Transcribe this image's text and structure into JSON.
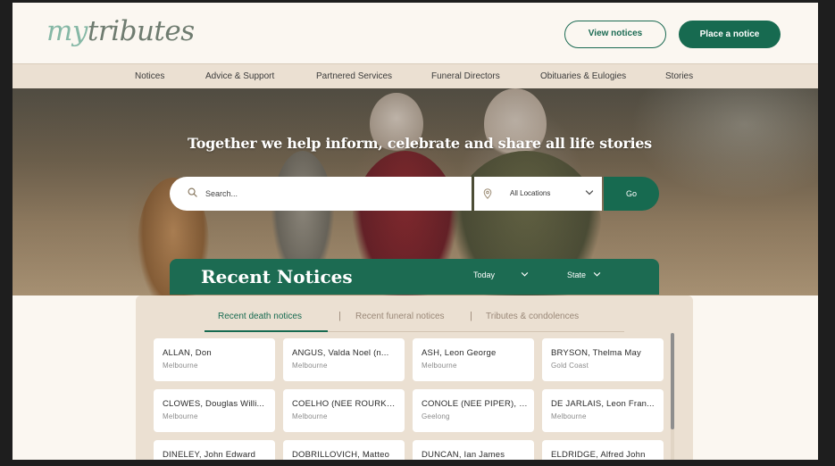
{
  "brand": {
    "logo_prefix": "my",
    "logo_suffix": "tributes"
  },
  "header": {
    "view_notices": "View notices",
    "place_notice": "Place a notice"
  },
  "nav": {
    "items": [
      {
        "label": "Notices"
      },
      {
        "label": "Advice & Support"
      },
      {
        "label": "Partnered Services"
      },
      {
        "label": "Funeral Directors"
      },
      {
        "label": "Obituaries & Eulogies"
      },
      {
        "label": "Stories"
      }
    ]
  },
  "hero": {
    "title": "Together we help inform, celebrate and share all life stories",
    "search_placeholder": "Search...",
    "location": "All Locations",
    "go": "Go"
  },
  "recent": {
    "title": "Recent Notices",
    "filter_period": "Today",
    "filter_state": "State",
    "tabs": [
      {
        "label": "Recent death notices"
      },
      {
        "label": "Recent funeral notices"
      },
      {
        "label": "Tributes & condolences"
      }
    ],
    "tab_separator": "|",
    "notices": [
      {
        "name": "ALLAN, Don",
        "location": "Melbourne"
      },
      {
        "name": "ANGUS, Valda Noel (n...",
        "location": "Melbourne"
      },
      {
        "name": "ASH, Leon George",
        "location": "Melbourne"
      },
      {
        "name": "BRYSON, Thelma May",
        "location": "Gold Coast"
      },
      {
        "name": "CLOWES, Douglas Willi...",
        "location": "Melbourne"
      },
      {
        "name": "COELHO (NEE ROURKE),...",
        "location": "Melbourne"
      },
      {
        "name": "CONOLE (NEE PIPER), M...",
        "location": "Geelong"
      },
      {
        "name": "DE JARLAIS, Leon Fran...",
        "location": "Melbourne"
      },
      {
        "name": "DINELEY, John Edward",
        "location": ""
      },
      {
        "name": "DOBRILLOVICH, Matteo",
        "location": ""
      },
      {
        "name": "DUNCAN, Ian James",
        "location": ""
      },
      {
        "name": "ELDRIDGE, Alfred John",
        "location": ""
      }
    ]
  },
  "colors": {
    "brand_green": "#176a50",
    "cream": "#fbf7f1",
    "beige": "#ebe0d2"
  },
  "icons": {
    "search": "search-icon",
    "location": "map-pin-icon",
    "dropdown": "chevron-down-icon"
  }
}
